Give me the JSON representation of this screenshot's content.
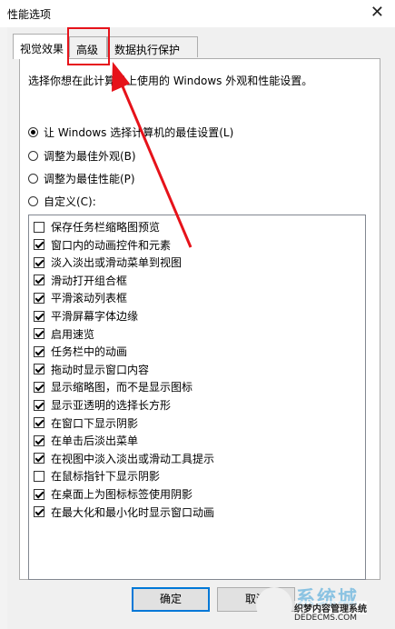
{
  "window": {
    "title": "性能选项",
    "close_glyph": "✕"
  },
  "tabs": [
    {
      "label": "视觉效果",
      "active": true
    },
    {
      "label": "高级",
      "active": false
    },
    {
      "label": "数据执行保护",
      "active": false
    }
  ],
  "description": "选择你想在此计算机上使用的 Windows 外观和性能设置。",
  "radios": [
    {
      "label": "让 Windows 选择计算机的最佳设置(L)",
      "checked": true
    },
    {
      "label": "调整为最佳外观(B)",
      "checked": false
    },
    {
      "label": "调整为最佳性能(P)",
      "checked": false
    },
    {
      "label": "自定义(C):",
      "checked": false
    }
  ],
  "effects": [
    {
      "label": "保存任务栏缩略图预览",
      "checked": false
    },
    {
      "label": "窗口内的动画控件和元素",
      "checked": true
    },
    {
      "label": "淡入淡出或滑动菜单到视图",
      "checked": true
    },
    {
      "label": "滑动打开组合框",
      "checked": true
    },
    {
      "label": "平滑滚动列表框",
      "checked": true
    },
    {
      "label": "平滑屏幕字体边缘",
      "checked": true
    },
    {
      "label": "启用速览",
      "checked": true
    },
    {
      "label": "任务栏中的动画",
      "checked": true
    },
    {
      "label": "拖动时显示窗口内容",
      "checked": true
    },
    {
      "label": "显示缩略图，而不是显示图标",
      "checked": true
    },
    {
      "label": "显示亚透明的选择长方形",
      "checked": true
    },
    {
      "label": "在窗口下显示阴影",
      "checked": true
    },
    {
      "label": "在单击后淡出菜单",
      "checked": true
    },
    {
      "label": "在视图中淡入淡出或滑动工具提示",
      "checked": true
    },
    {
      "label": "在鼠标指针下显示阴影",
      "checked": false
    },
    {
      "label": "在桌面上为图标标签使用阴影",
      "checked": true
    },
    {
      "label": "在最大化和最小化时显示窗口动画",
      "checked": true
    }
  ],
  "buttons": {
    "ok": "确定",
    "cancel": "取消"
  },
  "annotation": {
    "color": "#e6121a"
  },
  "watermark": {
    "brand": "系统城",
    "line1": "织梦内容管理系统",
    "line2": "DEDECMS.COM"
  }
}
